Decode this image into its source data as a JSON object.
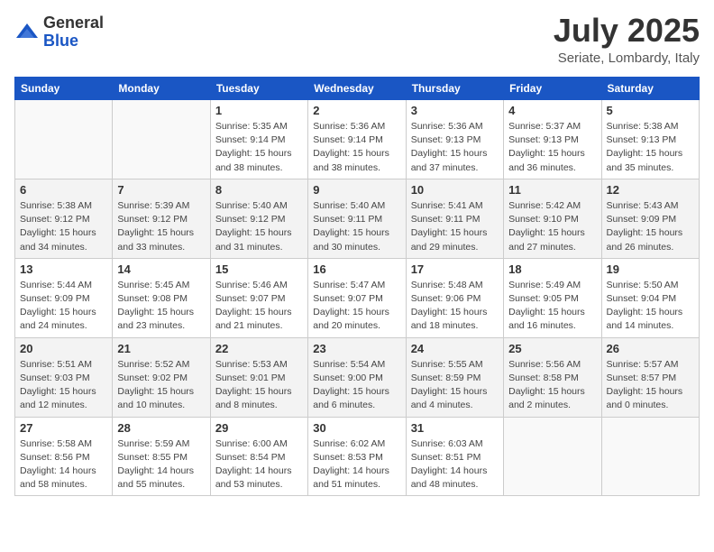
{
  "header": {
    "logo_general": "General",
    "logo_blue": "Blue",
    "month_title": "July 2025",
    "location": "Seriate, Lombardy, Italy"
  },
  "days_of_week": [
    "Sunday",
    "Monday",
    "Tuesday",
    "Wednesday",
    "Thursday",
    "Friday",
    "Saturday"
  ],
  "weeks": [
    [
      {
        "day": "",
        "info": ""
      },
      {
        "day": "",
        "info": ""
      },
      {
        "day": "1",
        "info": "Sunrise: 5:35 AM\nSunset: 9:14 PM\nDaylight: 15 hours and 38 minutes."
      },
      {
        "day": "2",
        "info": "Sunrise: 5:36 AM\nSunset: 9:14 PM\nDaylight: 15 hours and 38 minutes."
      },
      {
        "day": "3",
        "info": "Sunrise: 5:36 AM\nSunset: 9:13 PM\nDaylight: 15 hours and 37 minutes."
      },
      {
        "day": "4",
        "info": "Sunrise: 5:37 AM\nSunset: 9:13 PM\nDaylight: 15 hours and 36 minutes."
      },
      {
        "day": "5",
        "info": "Sunrise: 5:38 AM\nSunset: 9:13 PM\nDaylight: 15 hours and 35 minutes."
      }
    ],
    [
      {
        "day": "6",
        "info": "Sunrise: 5:38 AM\nSunset: 9:12 PM\nDaylight: 15 hours and 34 minutes."
      },
      {
        "day": "7",
        "info": "Sunrise: 5:39 AM\nSunset: 9:12 PM\nDaylight: 15 hours and 33 minutes."
      },
      {
        "day": "8",
        "info": "Sunrise: 5:40 AM\nSunset: 9:12 PM\nDaylight: 15 hours and 31 minutes."
      },
      {
        "day": "9",
        "info": "Sunrise: 5:40 AM\nSunset: 9:11 PM\nDaylight: 15 hours and 30 minutes."
      },
      {
        "day": "10",
        "info": "Sunrise: 5:41 AM\nSunset: 9:11 PM\nDaylight: 15 hours and 29 minutes."
      },
      {
        "day": "11",
        "info": "Sunrise: 5:42 AM\nSunset: 9:10 PM\nDaylight: 15 hours and 27 minutes."
      },
      {
        "day": "12",
        "info": "Sunrise: 5:43 AM\nSunset: 9:09 PM\nDaylight: 15 hours and 26 minutes."
      }
    ],
    [
      {
        "day": "13",
        "info": "Sunrise: 5:44 AM\nSunset: 9:09 PM\nDaylight: 15 hours and 24 minutes."
      },
      {
        "day": "14",
        "info": "Sunrise: 5:45 AM\nSunset: 9:08 PM\nDaylight: 15 hours and 23 minutes."
      },
      {
        "day": "15",
        "info": "Sunrise: 5:46 AM\nSunset: 9:07 PM\nDaylight: 15 hours and 21 minutes."
      },
      {
        "day": "16",
        "info": "Sunrise: 5:47 AM\nSunset: 9:07 PM\nDaylight: 15 hours and 20 minutes."
      },
      {
        "day": "17",
        "info": "Sunrise: 5:48 AM\nSunset: 9:06 PM\nDaylight: 15 hours and 18 minutes."
      },
      {
        "day": "18",
        "info": "Sunrise: 5:49 AM\nSunset: 9:05 PM\nDaylight: 15 hours and 16 minutes."
      },
      {
        "day": "19",
        "info": "Sunrise: 5:50 AM\nSunset: 9:04 PM\nDaylight: 15 hours and 14 minutes."
      }
    ],
    [
      {
        "day": "20",
        "info": "Sunrise: 5:51 AM\nSunset: 9:03 PM\nDaylight: 15 hours and 12 minutes."
      },
      {
        "day": "21",
        "info": "Sunrise: 5:52 AM\nSunset: 9:02 PM\nDaylight: 15 hours and 10 minutes."
      },
      {
        "day": "22",
        "info": "Sunrise: 5:53 AM\nSunset: 9:01 PM\nDaylight: 15 hours and 8 minutes."
      },
      {
        "day": "23",
        "info": "Sunrise: 5:54 AM\nSunset: 9:00 PM\nDaylight: 15 hours and 6 minutes."
      },
      {
        "day": "24",
        "info": "Sunrise: 5:55 AM\nSunset: 8:59 PM\nDaylight: 15 hours and 4 minutes."
      },
      {
        "day": "25",
        "info": "Sunrise: 5:56 AM\nSunset: 8:58 PM\nDaylight: 15 hours and 2 minutes."
      },
      {
        "day": "26",
        "info": "Sunrise: 5:57 AM\nSunset: 8:57 PM\nDaylight: 15 hours and 0 minutes."
      }
    ],
    [
      {
        "day": "27",
        "info": "Sunrise: 5:58 AM\nSunset: 8:56 PM\nDaylight: 14 hours and 58 minutes."
      },
      {
        "day": "28",
        "info": "Sunrise: 5:59 AM\nSunset: 8:55 PM\nDaylight: 14 hours and 55 minutes."
      },
      {
        "day": "29",
        "info": "Sunrise: 6:00 AM\nSunset: 8:54 PM\nDaylight: 14 hours and 53 minutes."
      },
      {
        "day": "30",
        "info": "Sunrise: 6:02 AM\nSunset: 8:53 PM\nDaylight: 14 hours and 51 minutes."
      },
      {
        "day": "31",
        "info": "Sunrise: 6:03 AM\nSunset: 8:51 PM\nDaylight: 14 hours and 48 minutes."
      },
      {
        "day": "",
        "info": ""
      },
      {
        "day": "",
        "info": ""
      }
    ]
  ]
}
